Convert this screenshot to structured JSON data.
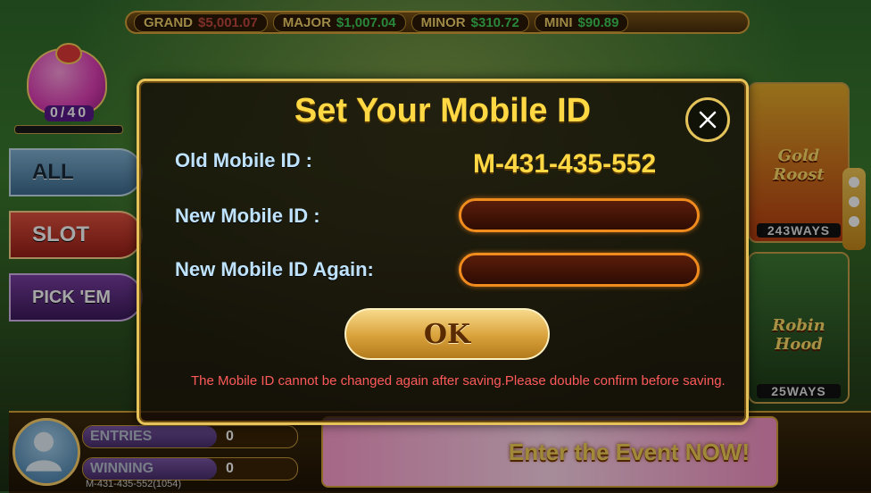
{
  "jackpots": [
    {
      "label": "GRAND",
      "value": "$5,001.07"
    },
    {
      "label": "MAJOR",
      "value": "$1,007.04"
    },
    {
      "label": "MINOR",
      "value": "$310.72"
    },
    {
      "label": "MINI",
      "value": "$90.89"
    }
  ],
  "gift": {
    "counter": "0/40"
  },
  "categories": {
    "all": "ALL",
    "slot": "SLOT",
    "pick": "PICK 'EM"
  },
  "games": [
    {
      "name": "Gold Roost",
      "ways": "243WAYS"
    },
    {
      "name": "Robin Hood",
      "ways": "25WAYS"
    }
  ],
  "player": {
    "entries_label": "ENTRIES",
    "entries_value": "0",
    "winning_label": "WINNING",
    "winning_value": "0",
    "id_line": "M-431-435-552(1054)"
  },
  "event_banner": "Enter the Event NOW!",
  "dialog": {
    "title": "Set Your Mobile ID",
    "old_label": "Old Mobile ID :",
    "old_value": "M-431-435-552",
    "new_label": "New Mobile ID :",
    "new_value": "",
    "again_label": "New Mobile ID Again:",
    "again_value": "",
    "ok_label": "OK",
    "warning": "The Mobile ID cannot be changed again after saving.Please double confirm before saving."
  },
  "colors": {
    "accent_gold": "#ffd844",
    "warning_red": "#ff5a5a",
    "input_border": "#f08b1e"
  }
}
